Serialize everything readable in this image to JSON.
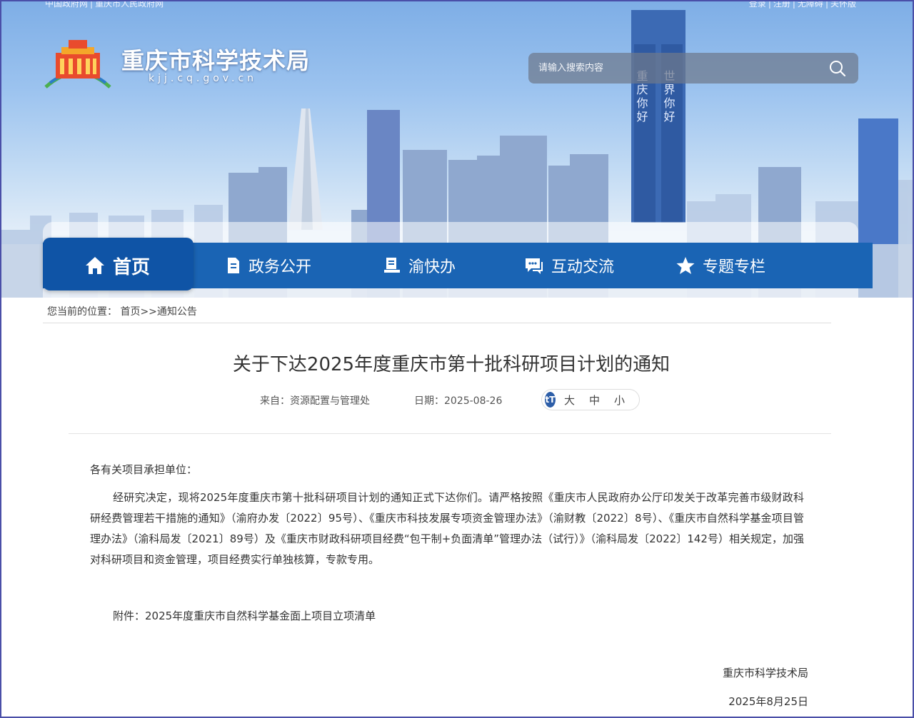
{
  "top_links": {
    "left": [
      "中国政府网",
      "重庆市人民政府网"
    ],
    "right": [
      "登录",
      "注册",
      "无障碍",
      "关怀版"
    ]
  },
  "header": {
    "site_name": "重庆市科学技术局",
    "domain": "kjj.cq.gov.cn",
    "search_placeholder": "请输入搜索内容",
    "billboard_text_1": "重庆你好",
    "billboard_text_2": "世界你好"
  },
  "nav": {
    "items": [
      {
        "label": "首页",
        "icon": "home-icon"
      },
      {
        "label": "政务公开",
        "icon": "document-icon"
      },
      {
        "label": "渝快办",
        "icon": "desk-icon"
      },
      {
        "label": "互动交流",
        "icon": "chat-icon"
      },
      {
        "label": "专题专栏",
        "icon": "star-icon"
      }
    ],
    "active_color": "#0f54a6",
    "bar_color": "#1a64b4"
  },
  "breadcrumb": {
    "prefix": "您当前的位置：",
    "home": "首页",
    "separator": ">>",
    "current": "通知公告"
  },
  "article": {
    "title": "关于下达2025年度重庆市第十批科研项目计划的通知",
    "source": "来自：资源配置与管理处",
    "date": "日期：2025-08-26",
    "font_icon": "tT",
    "font_sizes": [
      "大",
      "中",
      "小"
    ],
    "salutation": "各有关项目承担单位：",
    "body": "经研究决定，现将2025年度重庆市第十批科研项目计划的通知正式下达你们。请严格按照《重庆市人民政府办公厅印发关于改革完善市级财政科研经费管理若干措施的通知》（渝府办发〔2022〕95号）、《重庆市科技发展专项资金管理办法》（渝财教〔2022〕8号）、《重庆市自然科学基金项目管理办法》（渝科局发〔2021〕89号）及《重庆市财政科研项目经费“包干制+负面清单”管理办法（试行）》（渝科局发〔2022〕142号）相关规定，加强对科研项目和资金管理，项目经费实行单独核算，专款专用。",
    "attachment": "附件：2025年度重庆市自然科学基金面上项目立项清单",
    "signature": "重庆市科学技术局",
    "sign_date": "2025年8月25日"
  }
}
